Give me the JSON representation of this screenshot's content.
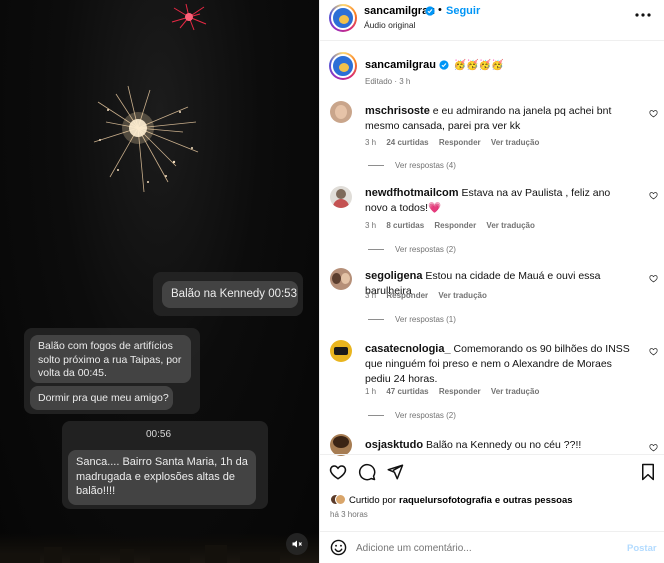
{
  "video": {
    "messages": {
      "msg1": "Balão na Kennedy 00:53",
      "msg2": "Balão com fogos de artifícios solto próximo a rua Taipas, por volta da 00:45.",
      "msg3": "Dormir pra que meu amigo?",
      "time": "00:56",
      "msg4": "Sanca.... Bairro Santa Maria, 1h da madrugada e explosões altas de balão!!!!"
    },
    "mute_icon": "speaker-muted-icon"
  },
  "header": {
    "username": "sancamilgrau",
    "separator": "•",
    "follow_label": "Seguir",
    "audio_label": "Áudio original",
    "more_icon": "more-horizontal-icon"
  },
  "caption": {
    "username": "sancamilgrau",
    "text": "🥳🥳🥳🥳",
    "edited": "Editado · 3 h"
  },
  "comments": [
    {
      "username": "mschrisoste",
      "text": "e eu admirando na janela pq achei bnt mesmo cansada, parei pra ver kk",
      "time": "3 h",
      "likes": "24 curtidas",
      "reply": "Responder",
      "translate": "Ver tradução",
      "replies": "Ver respostas (4)"
    },
    {
      "username": "newdfhotmailcom",
      "text": "Estava na av Paulista , feliz ano novo a todos!💗",
      "time": "3 h",
      "likes": "8 curtidas",
      "reply": "Responder",
      "translate": "Ver tradução",
      "replies": "Ver respostas (2)"
    },
    {
      "username": "segoligena",
      "text": "Estou na cidade de Mauá e ouvi essa barulheira",
      "time": "3 h",
      "reply": "Responder",
      "translate": "Ver tradução",
      "replies": "Ver respostas (1)"
    },
    {
      "username": "casatecnologia_",
      "text": "Comemorando os 90 bilhões do INSS que ninguém foi preso e nem o Alexandre de Moraes pediu 24 horas.",
      "time": "1 h",
      "likes": "47 curtidas",
      "reply": "Responder",
      "translate": "Ver tradução",
      "replies": "Ver respostas (2)"
    },
    {
      "username": "osjasktudo",
      "text": "Balão na Kennedy ou no céu ??!!"
    }
  ],
  "actions": {
    "like_icon": "heart-icon",
    "comment_icon": "comment-icon",
    "share_icon": "send-icon",
    "save_icon": "bookmark-icon"
  },
  "likes": {
    "prefix": "Curtido por",
    "user": "raquelursofotografia",
    "suffix": "e outras pessoas"
  },
  "timestamp": "há 3 horas",
  "composer": {
    "emoji_icon": "smiley-icon",
    "placeholder": "Adicione um comentário...",
    "post_label": "Postar",
    "post_color": "#b3dbff"
  },
  "colors": {
    "accent": "#0095f6",
    "heart_red": "#ff3040"
  }
}
